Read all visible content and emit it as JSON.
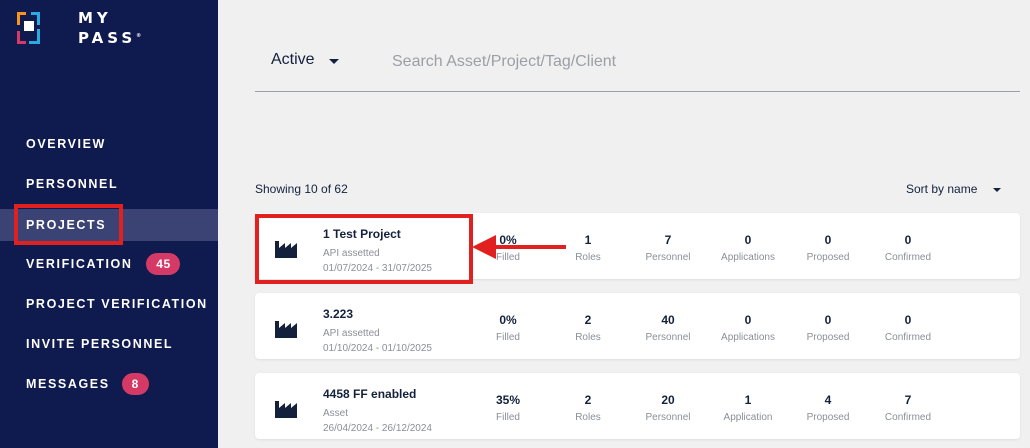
{
  "brand": {
    "line1": "MY",
    "line2": "PASS",
    "mark": "®"
  },
  "nav": [
    {
      "label": "OVERVIEW"
    },
    {
      "label": "PERSONNEL"
    },
    {
      "label": "PROJECTS",
      "active": true
    },
    {
      "label": "VERIFICATION",
      "badge": "45"
    },
    {
      "label": "PROJECT VERIFICATION"
    },
    {
      "label": "INVITE PERSONNEL"
    },
    {
      "label": "MESSAGES",
      "badge": "8"
    }
  ],
  "filter": {
    "status": "Active"
  },
  "search": {
    "placeholder": "Search Asset/Project/Tag/Client",
    "value": ""
  },
  "list": {
    "showing": "Showing 10 of 62",
    "sort": "Sort by name"
  },
  "stat_labels": {
    "filled": "Filled",
    "roles": "Roles",
    "personnel": "Personnel",
    "applications": "Applications",
    "application": "Application",
    "proposed": "Proposed",
    "confirmed": "Confirmed"
  },
  "projects": [
    {
      "name": "1 Test Project",
      "type": "API assetted",
      "dates": "01/07/2024 - 31/07/2025",
      "filled": "0%",
      "roles": "1",
      "personnel": "7",
      "applications": "0",
      "applications_label": "Applications",
      "proposed": "0",
      "confirmed": "0"
    },
    {
      "name": "3.223",
      "type": "API assetted",
      "dates": "01/10/2024 - 01/10/2025",
      "filled": "0%",
      "roles": "2",
      "personnel": "40",
      "applications": "0",
      "applications_label": "Applications",
      "proposed": "0",
      "confirmed": "0"
    },
    {
      "name": "4458 FF enabled",
      "type": "Asset",
      "dates": "26/04/2024 - 26/12/2024",
      "filled": "35%",
      "roles": "2",
      "personnel": "20",
      "applications": "1",
      "applications_label": "Application",
      "proposed": "4",
      "confirmed": "7"
    }
  ],
  "colors": {
    "sidebar": "#0f1a4f",
    "active_nav": "#3a4373",
    "badge": "#d53a66",
    "highlight": "#e0211f",
    "logo_orange": "#f7941d",
    "logo_blue": "#29abe2",
    "logo_pink": "#d53a66"
  },
  "icons": {
    "project": "factory-icon",
    "filter": "chevron-down-icon",
    "sort": "chevron-down-icon",
    "annotation": "arrow-left-icon"
  }
}
